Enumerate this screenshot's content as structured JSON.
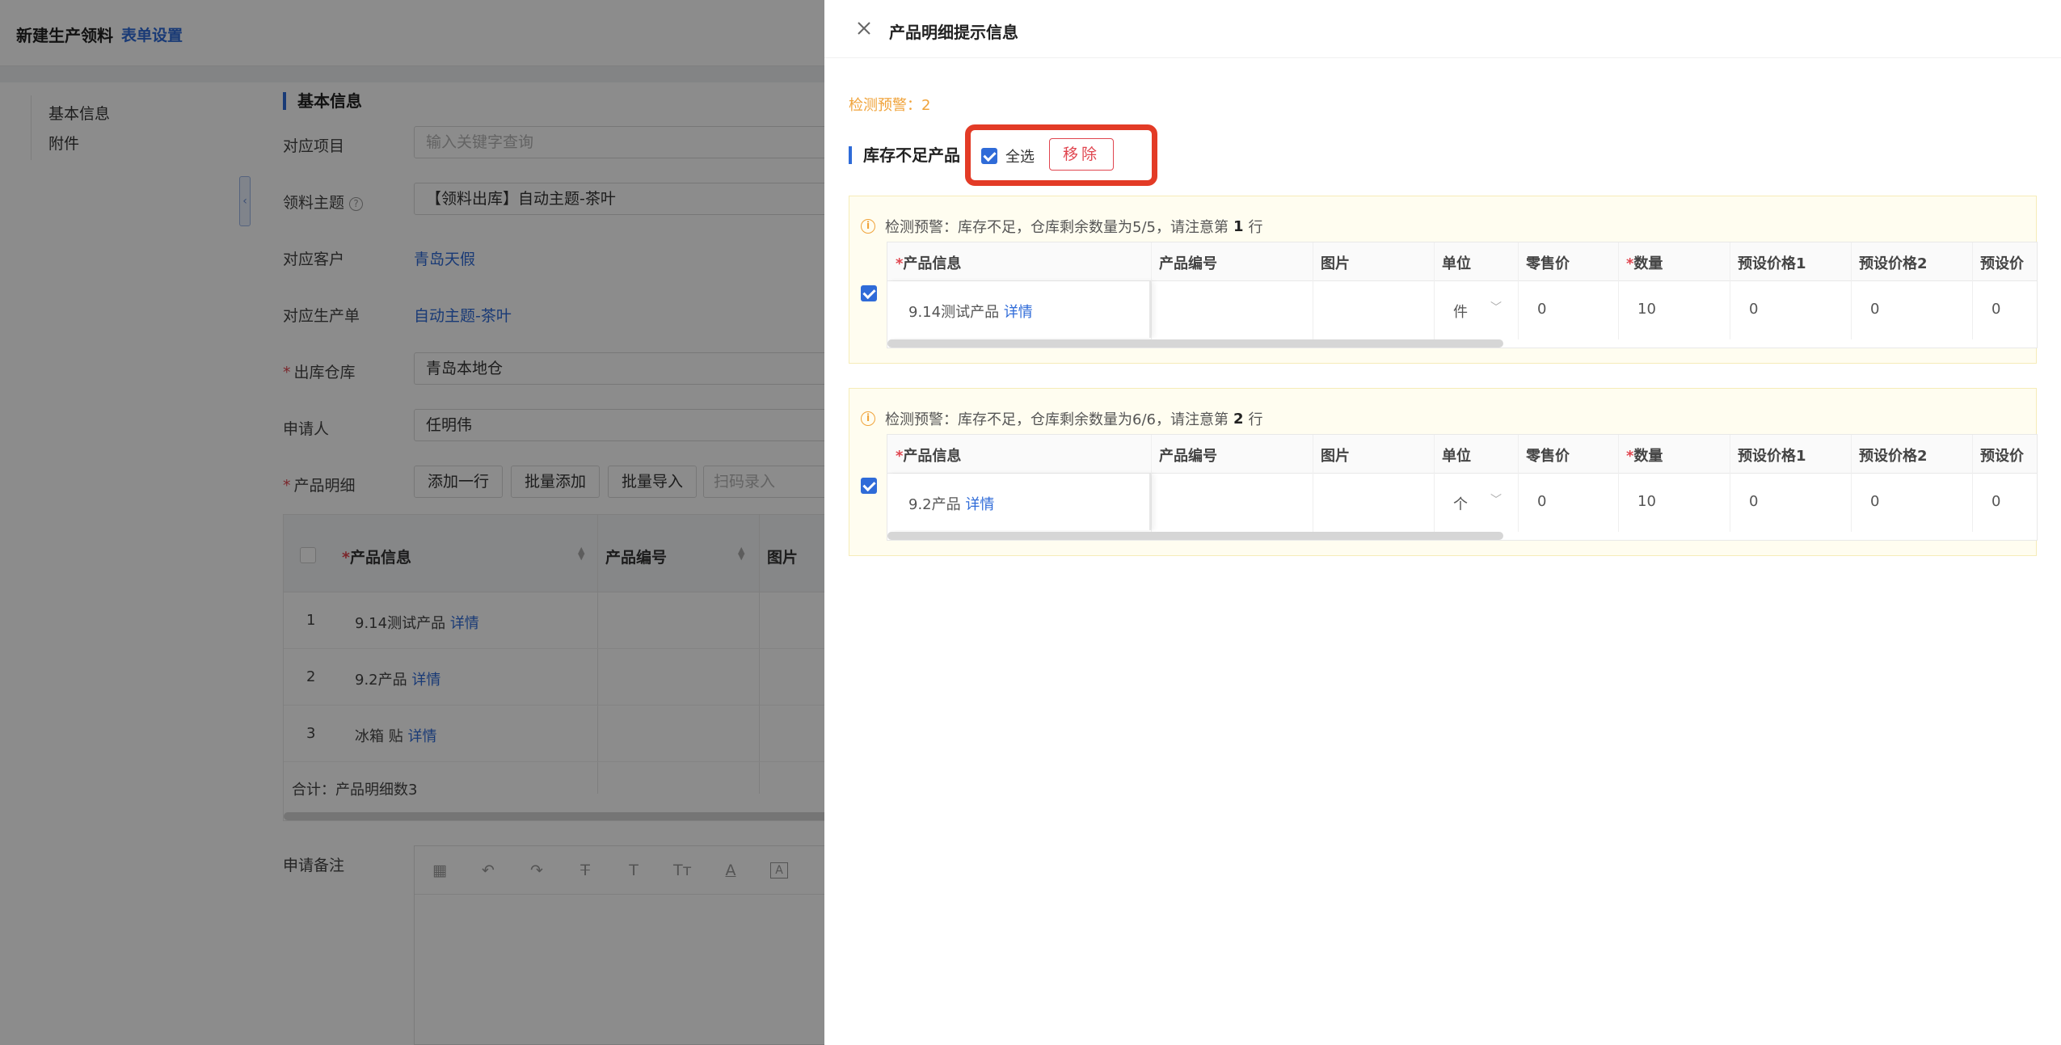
{
  "page": {
    "title": "新建生产领料",
    "form_settings": "表单设置",
    "nav": [
      "基本信息",
      "附件"
    ],
    "section_basic": "基本信息",
    "fields": {
      "project_label": "对应项目",
      "project_placeholder": "输入关键字查询",
      "subject_label": "领料主题",
      "subject_value": "【领料出库】自动主题-茶叶",
      "customer_label": "对应客户",
      "customer_value": "青岛天假",
      "order_label": "对应生产单",
      "order_value": "自动主题-茶叶",
      "warehouse_label": "出库仓库",
      "warehouse_value": "青岛本地仓",
      "applicant_label": "申请人",
      "applicant_value": "任明伟",
      "detail_label": "产品明细",
      "remark_label": "申请备注"
    },
    "detail_buttons": {
      "add_row": "添加一行",
      "batch_add": "批量添加",
      "batch_import": "批量导入",
      "scan_placeholder": "扫码录入"
    },
    "table": {
      "headers": [
        "*产品信息",
        "产品编号",
        "图片"
      ],
      "rows": [
        {
          "idx": "1",
          "name": "9.14测试产品",
          "link": "详情"
        },
        {
          "idx": "2",
          "name": "9.2产品",
          "link": "详情"
        },
        {
          "idx": "3",
          "name": "冰箱 贴",
          "link": "详情"
        }
      ],
      "total": "合计：产品明细数3"
    },
    "toolbar_icons": [
      "table-icon",
      "undo-icon",
      "redo-icon",
      "strikethrough-icon",
      "text-icon",
      "text-size-icon",
      "font-color-icon",
      "background-color-icon"
    ]
  },
  "drawer": {
    "title": "产品明细提示信息",
    "warn_count": "检测预警：2",
    "section_title": "库存不足产品",
    "select_all": "全选",
    "remove": "移除",
    "columns": [
      "*产品信息",
      "产品编号",
      "图片",
      "单位",
      "零售价",
      "*数量",
      "预设价格1",
      "预设价格2",
      "预设价"
    ],
    "cards": [
      {
        "msg_prefix": "检测预警：库存不足，仓库剩余数量为5/5，请注意第",
        "line_no": "1",
        "msg_suffix": "行",
        "product": "9.14测试产品",
        "link": "详情",
        "unit": "件",
        "retail": "0",
        "qty": "10",
        "price1": "0",
        "price2": "0",
        "price3": "0"
      },
      {
        "msg_prefix": "检测预警：库存不足，仓库剩余数量为6/6，请注意第",
        "line_no": "2",
        "msg_suffix": "行",
        "product": "9.2产品",
        "link": "详情",
        "unit": "个",
        "retail": "0",
        "qty": "10",
        "price1": "0",
        "price2": "0",
        "price3": "0"
      }
    ]
  },
  "colors": {
    "accent": "#2f6bd8",
    "warning": "#f0a33a",
    "danger": "#e0454f",
    "highlight": "#e33b26"
  }
}
